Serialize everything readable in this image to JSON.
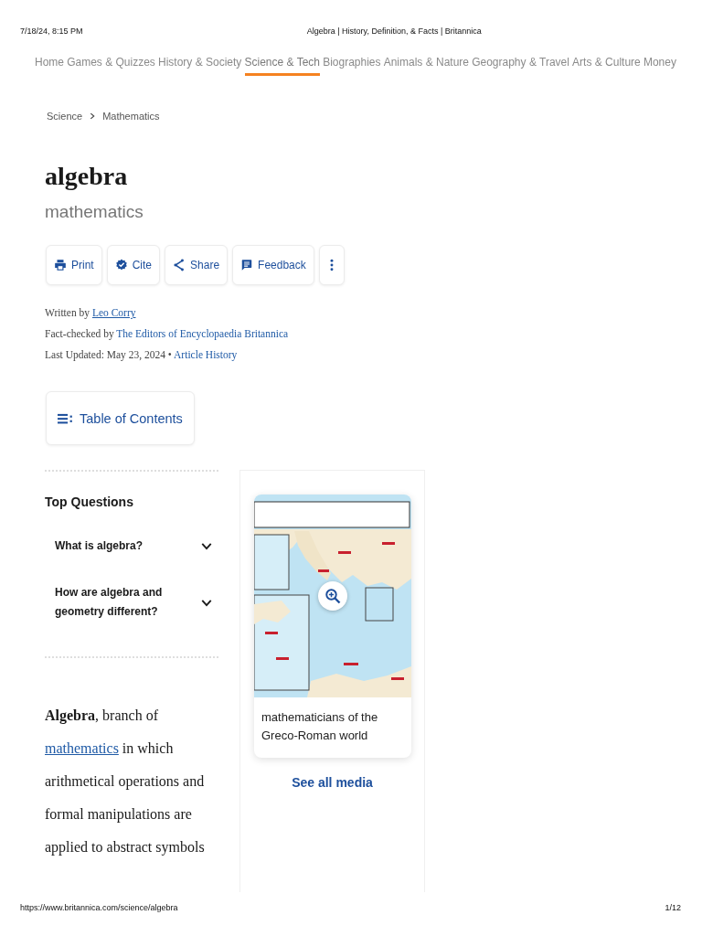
{
  "print_header": {
    "date": "7/18/24, 8:15 PM",
    "title": "Algebra | History, Definition, & Facts | Britannica"
  },
  "nav": [
    {
      "label": "Home",
      "selected": false
    },
    {
      "label": "Games & Quizzes",
      "selected": false
    },
    {
      "label": "History & Society",
      "selected": false
    },
    {
      "label": "Science & Tech",
      "selected": true
    },
    {
      "label": "Biographies",
      "selected": false
    },
    {
      "label": "Animals & Nature",
      "selected": false
    },
    {
      "label": "Geography & Travel",
      "selected": false
    },
    {
      "label": "Arts & Culture",
      "selected": false
    },
    {
      "label": "Money",
      "selected": false
    }
  ],
  "breadcrumb": [
    "Science",
    "Mathematics"
  ],
  "article": {
    "title": "algebra",
    "subtitle": "mathematics"
  },
  "actions": [
    {
      "kind": "print",
      "label": "Print"
    },
    {
      "kind": "cite",
      "label": "Cite"
    },
    {
      "kind": "share",
      "label": "Share"
    },
    {
      "kind": "feedback",
      "label": "Feedback"
    },
    {
      "kind": "more"
    }
  ],
  "byline": [
    {
      "text": "Written by",
      "link": "Leo Corry",
      "underlined": true
    },
    {
      "text": "Fact-checked by",
      "link": "The Editors of Encyclopaedia Britannica",
      "underlined": false
    },
    {
      "text": "Last Updated: May 23, 2024 •",
      "link": "Article History",
      "underlined": false
    }
  ],
  "toc": {
    "label": "Table of Contents"
  },
  "top_questions": {
    "title": "Top Questions",
    "items": [
      {
        "question": "What is algebra?",
        "expanded": false
      },
      {
        "question": "How are algebra and geometry different?",
        "expanded": false
      }
    ]
  },
  "intro": {
    "lead": "**Algebra**, branch of",
    "link": "mathematics",
    "rest": "in which arithmetical operations and formal manipulations are applied to abstract symbols"
  },
  "media": {
    "caption": "mathematicians of the Greco-Roman world",
    "see_all": "See all media"
  },
  "print_footer": {
    "url": "https://www.britannica.com/science/algebra",
    "page": "1/12"
  }
}
